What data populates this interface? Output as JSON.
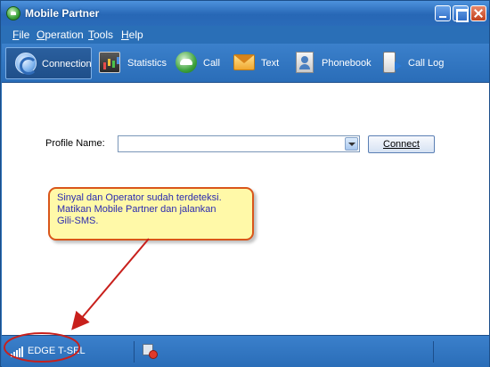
{
  "window": {
    "title": "Mobile Partner"
  },
  "menu": [
    "File",
    "Operation",
    "Tools",
    "Help"
  ],
  "toolbar": [
    {
      "label": "Connection",
      "icon": "connection-icon",
      "active": true
    },
    {
      "label": "Statistics",
      "icon": "statistics-icon",
      "active": false
    },
    {
      "label": "Call",
      "icon": "call-icon",
      "active": false
    },
    {
      "label": "Text",
      "icon": "text-icon",
      "active": false
    },
    {
      "label": "Phonebook",
      "icon": "phonebook-icon",
      "active": false
    },
    {
      "label": "Call Log",
      "icon": "call-log-icon",
      "active": false
    }
  ],
  "connection": {
    "profile_label": "Profile Name:",
    "profile_value": "",
    "connect_label": "Connect"
  },
  "callout": {
    "lines": [
      "Sinyal dan Operator sudah terdeteksi.",
      "Matikan Mobile Partner dan jalankan",
      "Gili-SMS."
    ]
  },
  "status": {
    "network": "EDGE  T-SEL"
  },
  "colors": {
    "titlebar": "#2767b5",
    "annotation": "#d9561a",
    "callout_bg": "#fff9a8",
    "callout_text": "#2b2bb0"
  }
}
